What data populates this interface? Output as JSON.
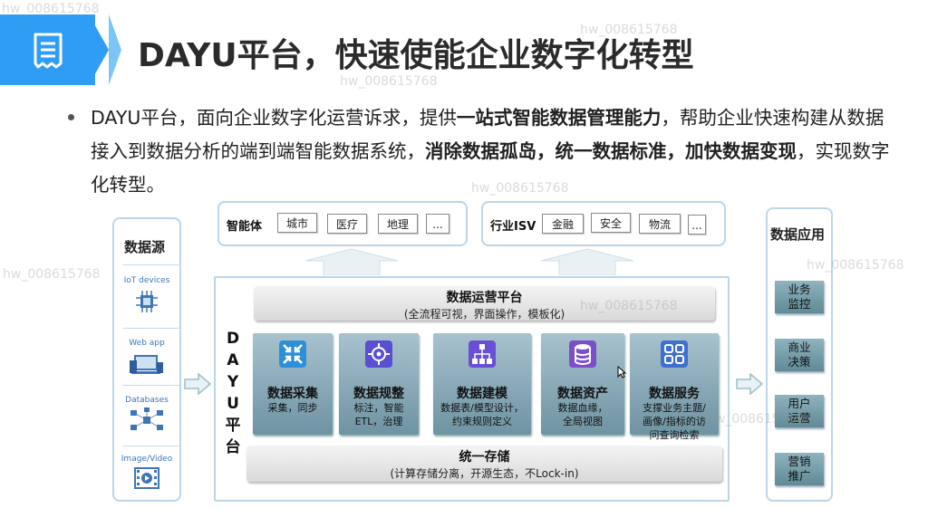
{
  "slide": {
    "title": "DAYU平台，快速使能企业数字化转型",
    "intro": {
      "p1": "DAYU平台，面向企业数字化运营诉求，提供",
      "b1": "一站式智能数据管理能力",
      "p2": "，帮助企业快速构建从数据接入到数据分析的端到端智能数据系统，",
      "b2": "消除数据孤岛，统一数据标准，加快数据变现",
      "p3": "，实现数字化转型。"
    }
  },
  "sources": {
    "title": "数据源",
    "items": [
      "IoT devices",
      "Web app",
      "Databases",
      "Image/Video"
    ]
  },
  "top": {
    "agent_label": "智能体",
    "agent_chips": [
      "城市",
      "医疗",
      "地理",
      "..."
    ],
    "isv_label": "行业ISV",
    "isv_chips": [
      "金融",
      "安全",
      "物流",
      "..."
    ]
  },
  "platform": {
    "vertical_label": [
      "D",
      "A",
      "Y",
      "U",
      "平",
      "台"
    ],
    "ops_title": "数据运营平台",
    "ops_sub": "(全流程可视，界面操作，模板化)",
    "modules": [
      {
        "title": "数据采集",
        "desc": "采集，同步",
        "icon_color": "#2f8fd6",
        "icon": "collect-icon"
      },
      {
        "title": "数据规整",
        "desc": "标注，智能\nETL，治理",
        "icon_color": "#5a4fd0",
        "icon": "gear-brain-icon"
      },
      {
        "title": "数据建模",
        "desc": "数据表/模型设计，\n约束规则定义",
        "icon_color": "#6a4fd6",
        "icon": "hierarchy-icon"
      },
      {
        "title": "数据资产",
        "desc": "数据血缘，\n全局视图",
        "icon_color": "#7a4fc8",
        "icon": "database-icon"
      },
      {
        "title": "数据服务",
        "desc": "支撑业务主题/\n画像/指标的访\n问查询检索",
        "icon_color": "#3f6fd0",
        "icon": "grid-icon"
      }
    ],
    "storage_title": "统一存储",
    "storage_sub": "(计算存储分离，开源生态，不Lock-in)"
  },
  "apps": {
    "title": "数据应用",
    "items": [
      "业务\n监控",
      "商业\n决策",
      "用户\n运营",
      "营销\n推广"
    ]
  },
  "watermark": "hw_008615768",
  "colors": {
    "accent": "#2f9df3",
    "module": "#7f9fad",
    "panel_border": "#bcd6e8"
  }
}
